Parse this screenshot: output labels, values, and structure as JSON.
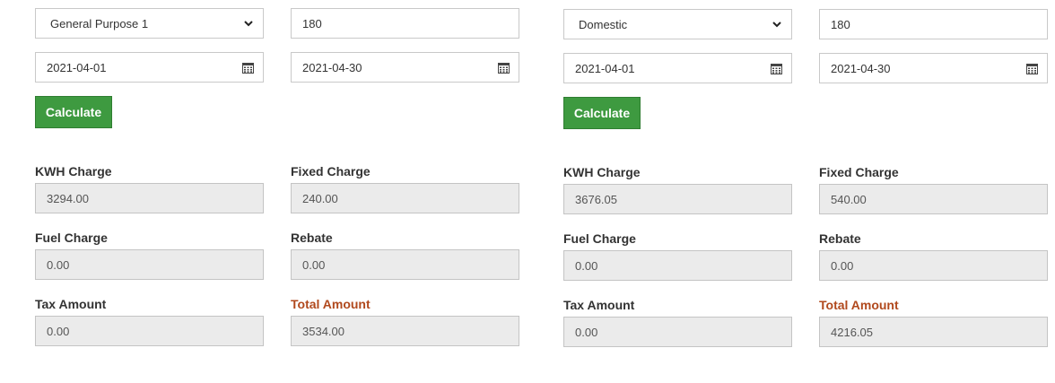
{
  "left": {
    "category": {
      "selected": "General Purpose 1"
    },
    "units": {
      "value": "180"
    },
    "from_date": {
      "value": "2021-04-01"
    },
    "to_date": {
      "value": "2021-04-30"
    },
    "calculate_label": "Calculate",
    "results": {
      "kwh_charge": {
        "label": "KWH Charge",
        "value": "3294.00"
      },
      "fixed_charge": {
        "label": "Fixed Charge",
        "value": "240.00"
      },
      "fuel_charge": {
        "label": "Fuel Charge",
        "value": "0.00"
      },
      "rebate": {
        "label": "Rebate",
        "value": "0.00"
      },
      "tax_amount": {
        "label": "Tax Amount",
        "value": "0.00"
      },
      "total_amount": {
        "label": "Total Amount",
        "value": "3534.00"
      }
    }
  },
  "right": {
    "category": {
      "selected": "Domestic"
    },
    "units": {
      "value": "180"
    },
    "from_date": {
      "value": "2021-04-01"
    },
    "to_date": {
      "value": "2021-04-30"
    },
    "calculate_label": "Calculate",
    "results": {
      "kwh_charge": {
        "label": "KWH Charge",
        "value": "3676.05"
      },
      "fixed_charge": {
        "label": "Fixed Charge",
        "value": "540.00"
      },
      "fuel_charge": {
        "label": "Fuel Charge",
        "value": "0.00"
      },
      "rebate": {
        "label": "Rebate",
        "value": "0.00"
      },
      "tax_amount": {
        "label": "Tax Amount",
        "value": "0.00"
      },
      "total_amount": {
        "label": "Total Amount",
        "value": "4216.05"
      }
    }
  },
  "icons": {
    "dropdown": "chevron-down-icon",
    "date_picker": "calendar-icon"
  },
  "colors": {
    "button_bg": "#3e9a40",
    "total_label": "#b1491d",
    "readonly_bg": "#ebebeb"
  }
}
